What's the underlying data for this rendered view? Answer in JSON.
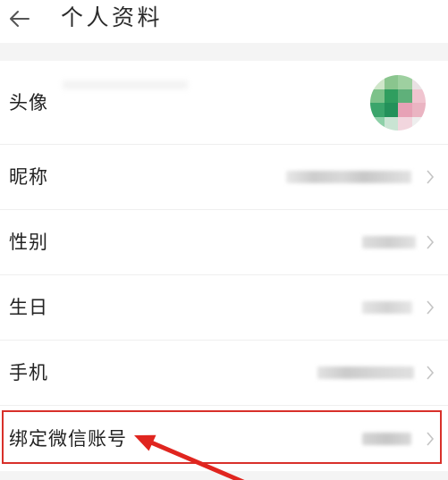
{
  "header": {
    "back_icon": "arrow-left-icon",
    "title": "个人资料"
  },
  "rows": [
    {
      "label": "头像"
    },
    {
      "label": "昵称",
      "trailing_icon": "chevron-right-icon"
    },
    {
      "label": "性别",
      "trailing_icon": "chevron-right-icon"
    },
    {
      "label": "生日",
      "trailing_icon": "chevron-right-icon"
    },
    {
      "label": "手机",
      "trailing_icon": "chevron-right-icon"
    },
    {
      "label": "绑定微信账号",
      "trailing_icon": "chevron-right-icon"
    }
  ],
  "colors": {
    "page_background": "#f4f4f4",
    "row_background": "#ffffff",
    "label_text": "#222222",
    "annotation_red": "#d8302a"
  }
}
